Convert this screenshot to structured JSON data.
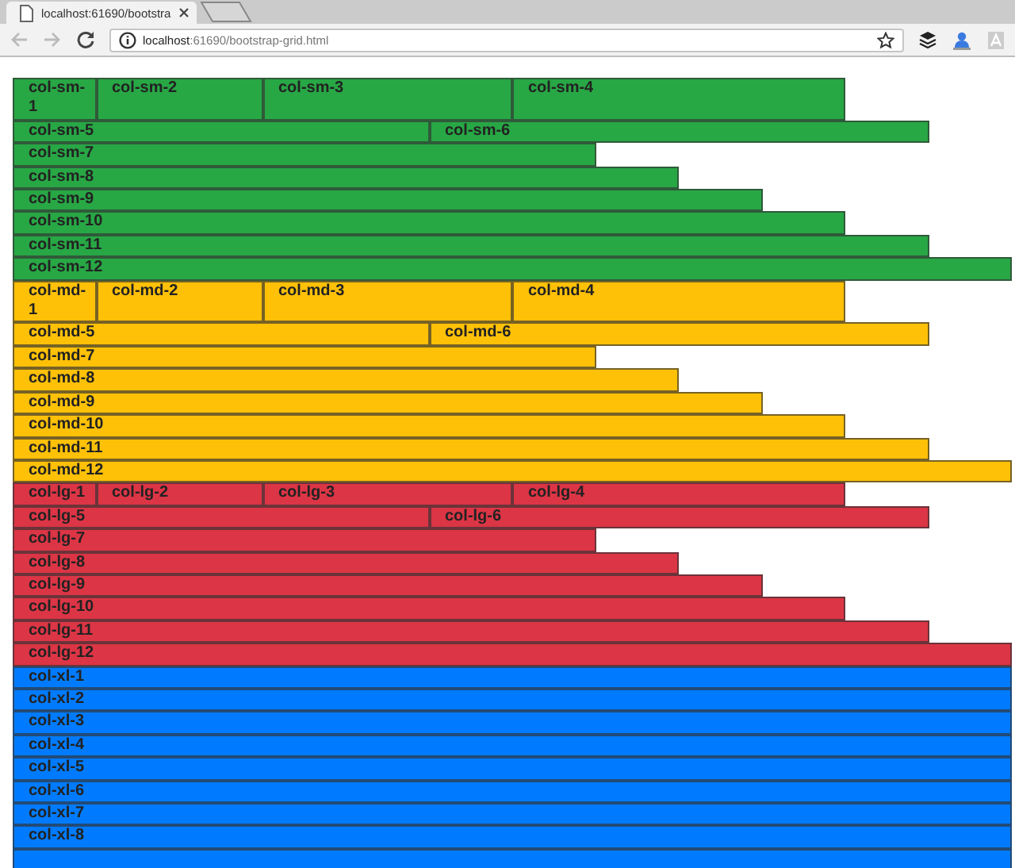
{
  "browser": {
    "tab": {
      "title": "localhost:61690/bootstra"
    },
    "back": {
      "disabled": true
    },
    "forward": {
      "disabled": true
    },
    "address": {
      "host": "localhost",
      "path": ":61690/bootstrap-grid.html"
    }
  },
  "groups": [
    {
      "color": "#28a745",
      "stacked": false,
      "rows": [
        [
          "col-sm-1",
          "col-sm-2",
          "col-sm-3",
          "col-sm-4"
        ],
        [
          "col-sm-5",
          "col-sm-6"
        ],
        [
          "col-sm-7"
        ],
        [
          "col-sm-8"
        ],
        [
          "col-sm-9"
        ],
        [
          "col-sm-10"
        ],
        [
          "col-sm-11"
        ],
        [
          "col-sm-12"
        ]
      ]
    },
    {
      "color": "#ffc107",
      "stacked": false,
      "rows": [
        [
          "col-md-1",
          "col-md-2",
          "col-md-3",
          "col-md-4"
        ],
        [
          "col-md-5",
          "col-md-6"
        ],
        [
          "col-md-7"
        ],
        [
          "col-md-8"
        ],
        [
          "col-md-9"
        ],
        [
          "col-md-10"
        ],
        [
          "col-md-11"
        ],
        [
          "col-md-12"
        ]
      ]
    },
    {
      "color": "#dc3545",
      "stacked": false,
      "rows": [
        [
          "col-lg-1",
          "col-lg-2",
          "col-lg-3",
          "col-lg-4"
        ],
        [
          "col-lg-5",
          "col-lg-6"
        ],
        [
          "col-lg-7"
        ],
        [
          "col-lg-8"
        ],
        [
          "col-lg-9"
        ],
        [
          "col-lg-10"
        ],
        [
          "col-lg-11"
        ],
        [
          "col-lg-12"
        ]
      ]
    },
    {
      "color": "#007bff",
      "stacked": true,
      "rows": [
        [
          "col-xl-1"
        ],
        [
          "col-xl-2"
        ],
        [
          "col-xl-3"
        ],
        [
          "col-xl-4"
        ],
        [
          "col-xl-5"
        ],
        [
          "col-xl-6"
        ],
        [
          "col-xl-7"
        ],
        [
          "col-xl-8"
        ]
      ]
    }
  ]
}
